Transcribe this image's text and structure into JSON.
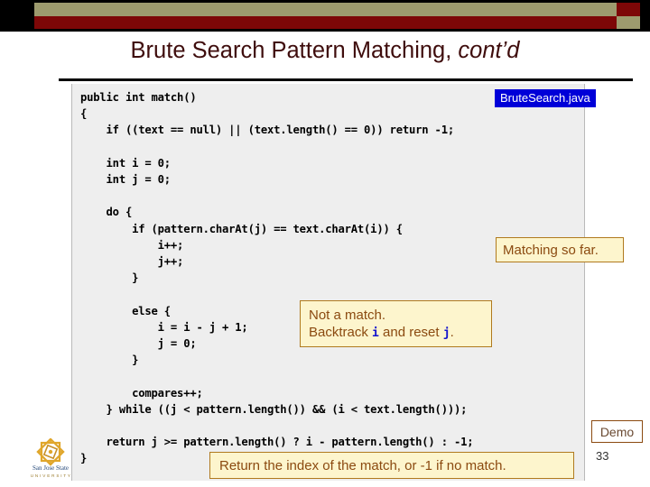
{
  "slide": {
    "title_main": "Brute Search Pattern Matching, ",
    "title_italic": "cont’d",
    "number": "33"
  },
  "theme": {
    "banner_olive": "#9d9b6e",
    "banner_maroon": "#7d0707",
    "title_color": "#3f0d0d",
    "callout_bg": "#fdf5cd",
    "callout_border": "#b07a1e",
    "callout_text": "#8b4a10",
    "filename_tag_bg": "#0000d8",
    "code_bg": "#eeeeee",
    "mono_accent": "#1414cd"
  },
  "code": {
    "filename_label": "BruteSearch.java",
    "listing": "public int match()\n{\n    if ((text == null) || (text.length() == 0)) return -1;\n\n    int i = 0;\n    int j = 0;\n\n    do {\n        if (pattern.charAt(j) == text.charAt(i)) {\n            i++;\n            j++;\n        }\n\n        else {\n            i = i - j + 1;\n            j = 0;\n        }\n\n        compares++;\n    } while ((j < pattern.length()) && (i < text.length()));\n\n    return j >= pattern.length() ? i - pattern.length() : -1;\n}"
  },
  "callouts": {
    "matching": "Matching so far.",
    "not_a_match_line1": "Not a match.",
    "not_a_match_line2_pre": "Backtrack ",
    "not_a_match_var1": "i",
    "not_a_match_line2_mid": " and reset ",
    "not_a_match_var2": "j",
    "not_a_match_line2_post": ".",
    "return_note": "Return the index of the match, or -1 if no match."
  },
  "buttons": {
    "demo_label": "Demo"
  },
  "logo": {
    "name_line1": "San Jose State",
    "name_line2": "U N I V E R S I T Y"
  }
}
